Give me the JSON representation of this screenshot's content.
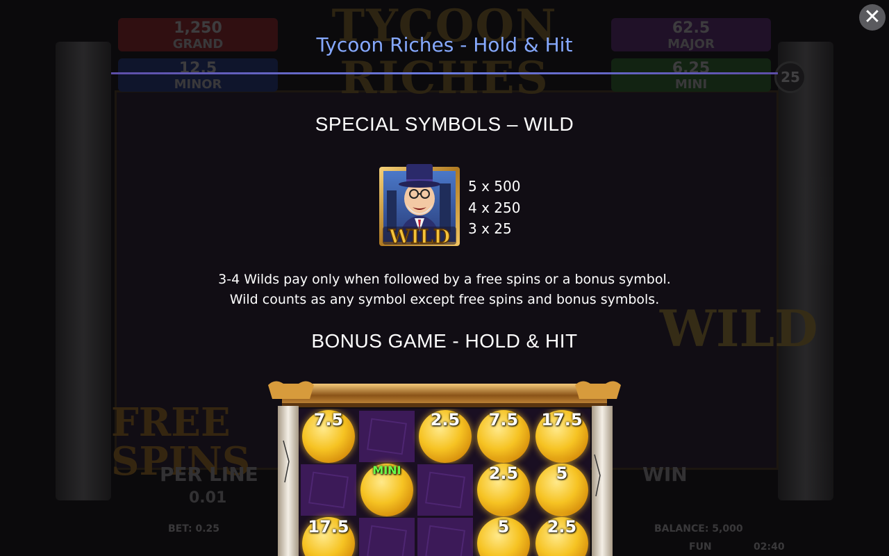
{
  "background": {
    "logo_text": "TYCOON RICHES",
    "jackpots": [
      {
        "value": "1,250",
        "label": "GRAND",
        "color": "#b32424"
      },
      {
        "value": "12.5",
        "label": "MINOR",
        "color": "#1f3f9c"
      },
      {
        "value": "62.5",
        "label": "MAJOR",
        "color": "#6a2a8c"
      },
      {
        "value": "6.25",
        "label": "MINI",
        "color": "#2b7d2b"
      }
    ],
    "badge": "25",
    "free_spins": "FREE\nSPINS",
    "wild_text": "WILD",
    "per_line_label": "PER LINE",
    "per_line_value": "0.01",
    "win_label": "WIN",
    "bet": "BET: 0.25",
    "balance": "BALANCE: 5,000",
    "fun": "FUN",
    "time": "02:40"
  },
  "overlay": {
    "close_label": "✕",
    "title": "Tycoon Riches - Hold & Hit",
    "wild_heading": "SPECIAL SYMBOLS – WILD",
    "wild_symbol_text": "WILD",
    "pays": [
      "5 x 500",
      "4 x 250",
      "3 x 25"
    ],
    "desc_line1": "3-4 Wilds pay only when followed by a free spins or a bonus symbol.",
    "desc_line2": "Wild counts as any symbol except free spins and bonus symbols.",
    "bonus_heading": "BONUS GAME - HOLD & HIT"
  },
  "bonus_grid": [
    [
      "7.5",
      "",
      "2.5",
      "7.5",
      "17.5"
    ],
    [
      "",
      "MINI",
      "",
      "2.5",
      "5"
    ],
    [
      "17.5",
      "",
      "",
      "5",
      "2.5"
    ]
  ]
}
